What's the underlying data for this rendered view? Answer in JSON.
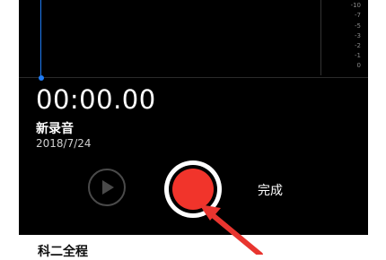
{
  "waveform": {
    "meter_ticks": [
      "-10",
      "-7",
      "-5",
      "-3",
      "-2",
      "-1",
      "0"
    ]
  },
  "recording": {
    "elapsed": "00:00.00",
    "title": "新录音",
    "date": "2018/7/24"
  },
  "controls": {
    "done_label": "完成"
  },
  "list": {
    "next_item_partial": "科二全程"
  },
  "colors": {
    "record": "#f1342b",
    "playhead": "#1f7cf5",
    "annotation_arrow": "#e8352f"
  },
  "icons": [
    "play-icon",
    "record-icon",
    "annotation-arrow"
  ]
}
